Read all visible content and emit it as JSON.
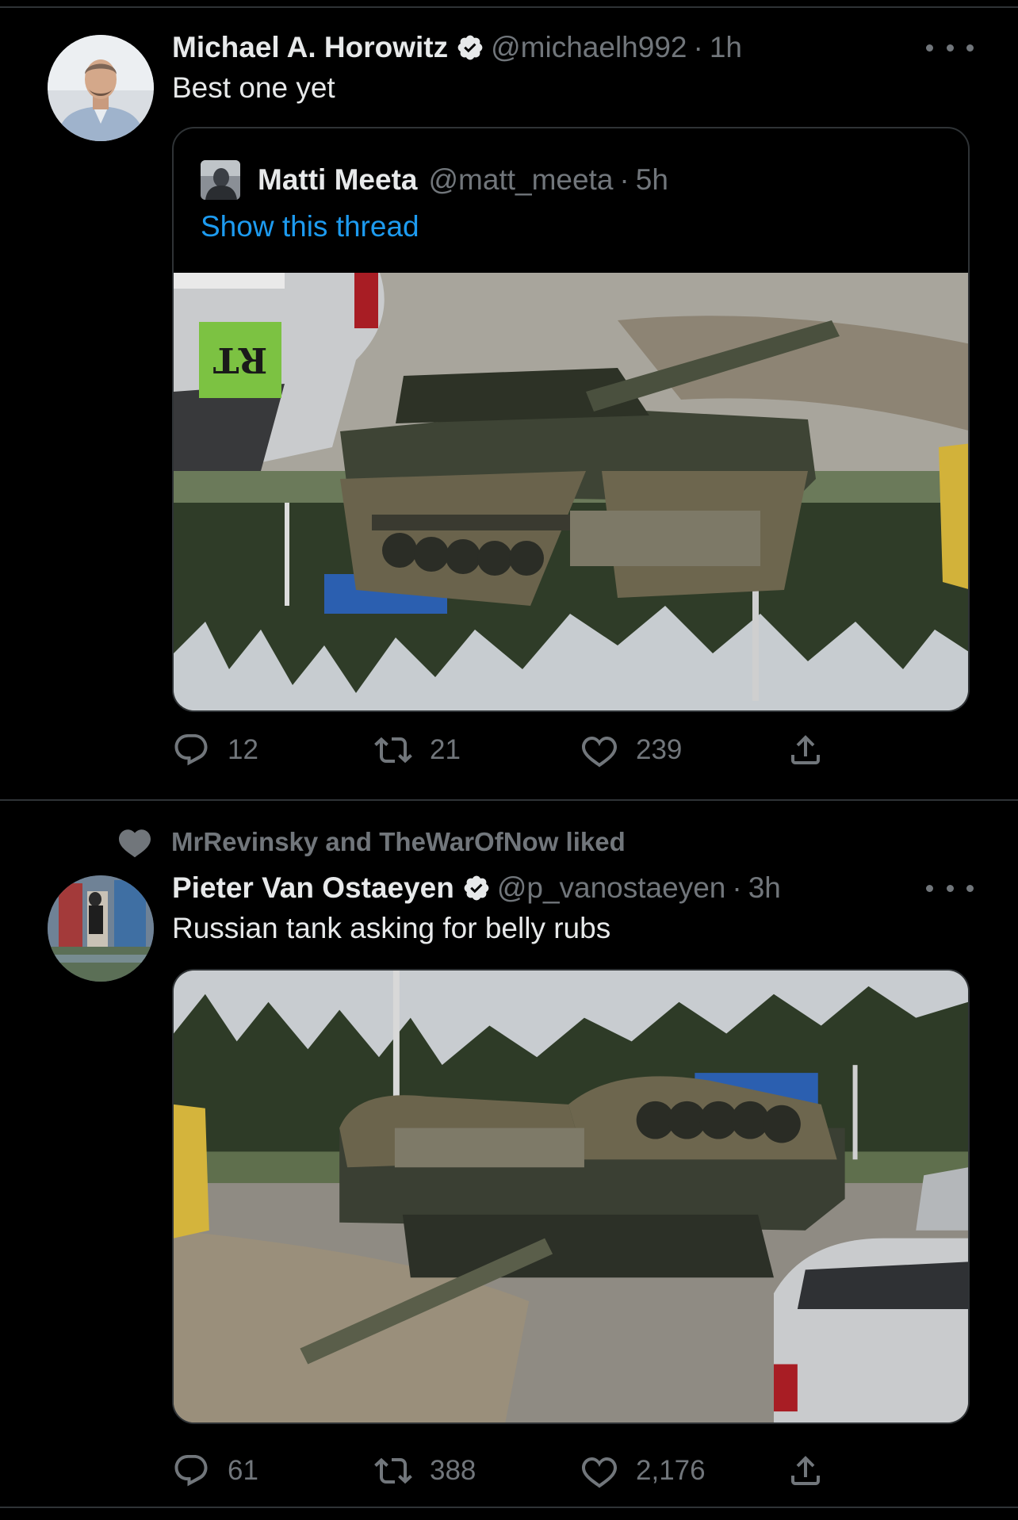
{
  "tweets": [
    {
      "author_name": "Michael A. Horowitz",
      "handle": "@michaelh992",
      "separator": "·",
      "time": "1h",
      "text": "Best one yet",
      "verified": true,
      "quote": {
        "author_name": "Matti Meeta",
        "handle": "@matt_meeta",
        "separator": "·",
        "time": "5h",
        "show_thread": "Show this thread",
        "media_badge": "RT"
      },
      "actions": {
        "replies": "12",
        "retweets": "21",
        "likes": "239"
      }
    },
    {
      "social_context": "MrRevinsky and TheWarOfNow liked",
      "author_name": "Pieter Van Ostaeyen",
      "handle": "@p_vanostaeyen",
      "separator": "·",
      "time": "3h",
      "text": "Russian tank asking for belly rubs",
      "verified": true,
      "actions": {
        "replies": "61",
        "retweets": "388",
        "likes": "2,176"
      }
    }
  ],
  "icons": {
    "verified": "verified-badge-icon",
    "more": "more-dots-icon",
    "reply": "reply-icon",
    "retweet": "retweet-icon",
    "like": "heart-icon",
    "share": "share-icon"
  },
  "colors": {
    "background": "#000000",
    "text": "#e7e9ea",
    "secondary": "#71767b",
    "link": "#1d9bf0",
    "divider": "#2f3336"
  }
}
